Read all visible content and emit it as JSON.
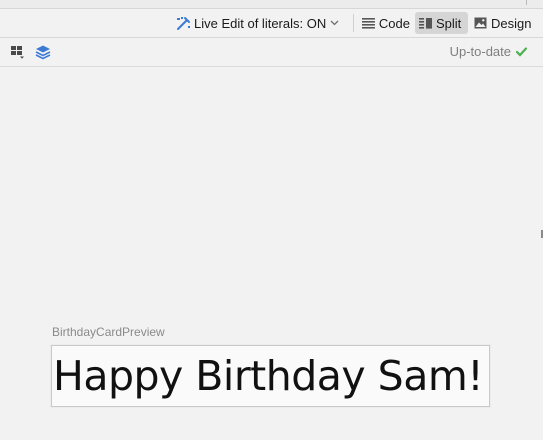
{
  "editor_toolbar": {
    "live_edit_label": "Live Edit of literals: ON",
    "modes": [
      {
        "label": "Code",
        "icon": "code-lines-icon",
        "selected": false
      },
      {
        "label": "Split",
        "icon": "split-view-icon",
        "selected": true
      },
      {
        "label": "Design",
        "icon": "image-icon",
        "selected": false
      }
    ]
  },
  "preview_toolbar": {
    "icons": [
      "layout-options-icon",
      "layers-icon"
    ],
    "status_text": "Up-to-date",
    "status_color": "#4caf50",
    "accent_color": "#3d7ad6"
  },
  "preview": {
    "name": "BirthdayCardPreview",
    "greeting_text": "Happy Birthday Sam!"
  }
}
